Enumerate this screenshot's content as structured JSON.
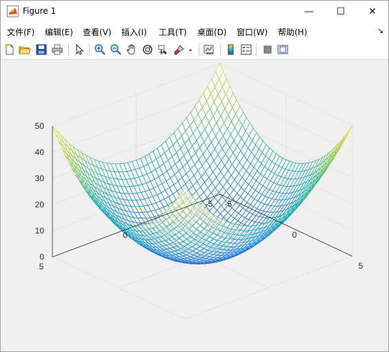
{
  "window": {
    "title": "Figure 1",
    "controls": {
      "minimize": "—",
      "maximize": "☐",
      "close": "✕"
    }
  },
  "menubar": {
    "items": [
      {
        "label": "文件(F)"
      },
      {
        "label": "编辑(E)"
      },
      {
        "label": "查看(V)"
      },
      {
        "label": "插入(I)"
      },
      {
        "label": "工具(T)"
      },
      {
        "label": "桌面(D)"
      },
      {
        "label": "窗口(W)"
      },
      {
        "label": "帮助(H)"
      }
    ],
    "overflow": "↘"
  },
  "toolbar": {
    "tools": [
      "new-figure",
      "open-file",
      "save",
      "print",
      "edit-pointer",
      "zoom-in",
      "zoom-out",
      "pan",
      "rotate-3d",
      "data-cursor",
      "brush",
      "insert-colorbar",
      "insert-legend",
      "hide-plot-tools",
      "show-plot-tools"
    ]
  },
  "colors": {
    "canvas": "#f0f0f0",
    "axes_grid": "#e3e3e3",
    "axes_line": "#262626",
    "surface_low": "#2a53c8",
    "surface_mid": "#20b2aa",
    "surface_high": "#f5e041"
  },
  "chart_data": {
    "type": "surface",
    "function": "z = x^2 + y^2",
    "x_range": [
      -5,
      5
    ],
    "y_range": [
      -5,
      5
    ],
    "z_range": [
      0,
      50
    ],
    "x_ticks": [
      "-5",
      "0",
      "5"
    ],
    "y_ticks": [
      "-5",
      "0",
      "5"
    ],
    "z_ticks": [
      "0",
      "10",
      "20",
      "30",
      "40",
      "50"
    ],
    "title": "",
    "xlabel": "",
    "ylabel": "",
    "zlabel": "",
    "colormap": "parula",
    "grid": true,
    "view": "3d-default"
  }
}
